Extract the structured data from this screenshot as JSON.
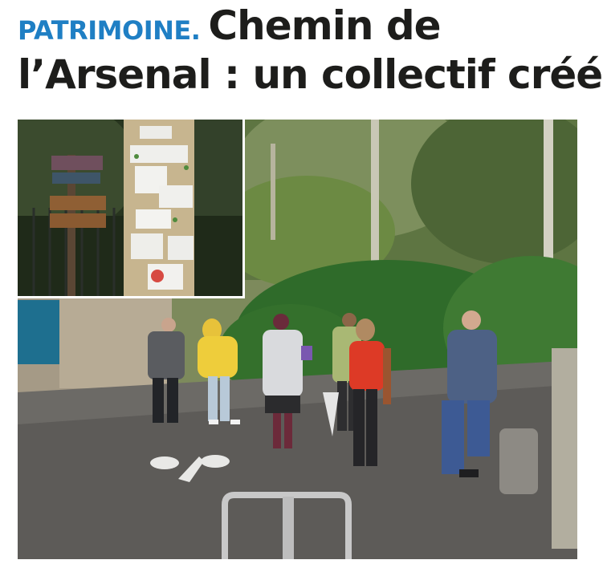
{
  "article": {
    "kicker": "PATRIMOINE.",
    "title_line1": "Chemin de",
    "title_line2": "l’Arsenal : un collectif créé"
  },
  "photo": {
    "content": "group-walk-on-chemin-de-l-arsenal",
    "inset": "signpost-with-posted-notices"
  }
}
